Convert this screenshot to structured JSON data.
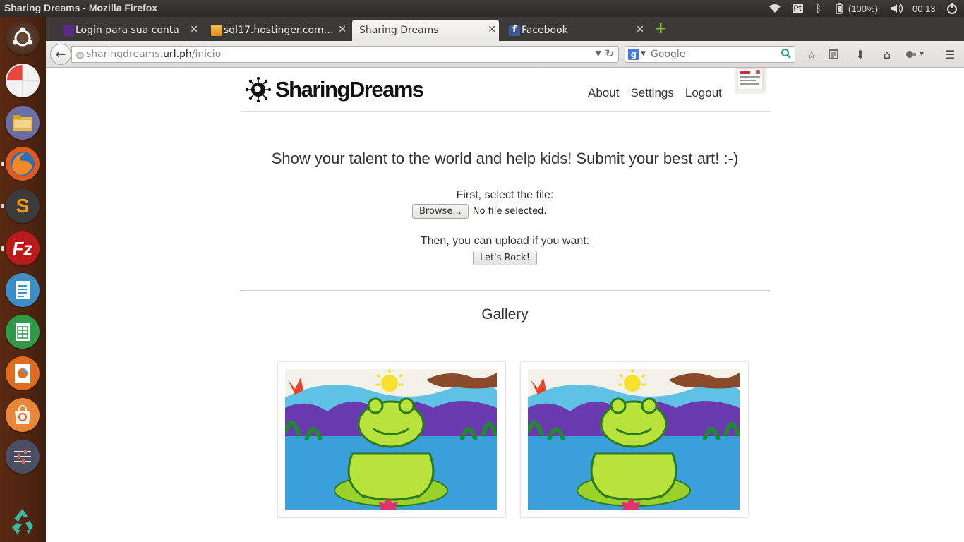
{
  "system": {
    "window_title": "Sharing Dreams - Mozilla Firefox",
    "keyboard_layout": "Pt",
    "battery": "(100%)",
    "clock": "00:13"
  },
  "launcher": {
    "apps": [
      "ubuntu-dash",
      "disk-usage",
      "files",
      "firefox",
      "sublime-text",
      "filezilla",
      "libreoffice-writer",
      "libreoffice-calc",
      "libreoffice-impress",
      "software-center",
      "system-settings",
      "trash"
    ]
  },
  "tabs": [
    {
      "label": "Login para sua conta",
      "active": false
    },
    {
      "label": "sql17.hostinger.com…",
      "active": false
    },
    {
      "label": "Sharing Dreams",
      "active": true
    },
    {
      "label": "Facebook",
      "active": false
    }
  ],
  "navbar": {
    "url_prefix": "sharingdreams.",
    "url_host": "url.ph",
    "url_path": "/inicio",
    "search_placeholder": "Google"
  },
  "site": {
    "logo": "SharingDreams",
    "nav": {
      "about": "About",
      "settings": "Settings",
      "logout": "Logout"
    },
    "headline": "Show your talent to the world and help kids! Submit your best art! :-)",
    "select_prompt": "First, select the file:",
    "browse_label": "Browse...",
    "file_status": "No file selected.",
    "upload_prompt": "Then, you can upload if you want:",
    "upload_button": "Let's Rock!",
    "gallery_title": "Gallery"
  },
  "colors": {
    "panel": "#3c3b37",
    "launcher": "#4c2411",
    "text": "#333333"
  }
}
